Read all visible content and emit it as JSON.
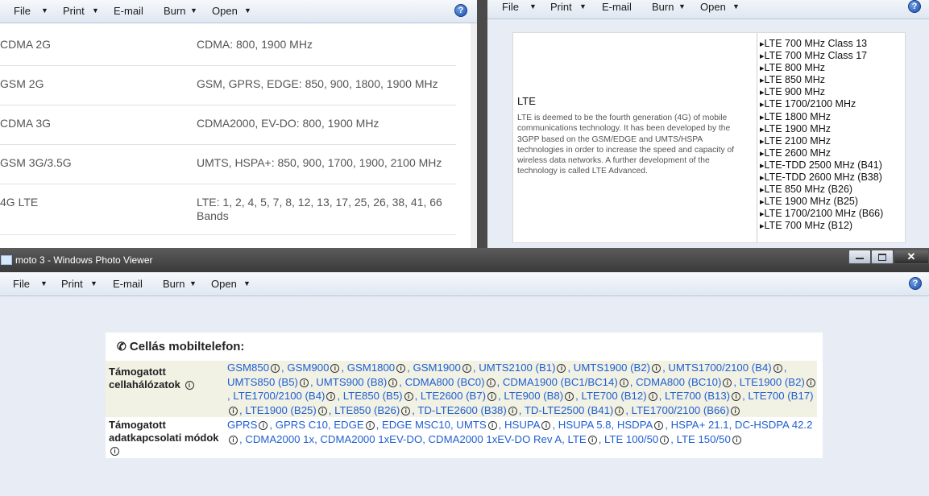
{
  "menu": {
    "file": "File",
    "print": "Print",
    "email": "E-mail",
    "burn": "Burn",
    "open": "Open"
  },
  "help_glyph": "?",
  "left_window": {
    "rows": [
      {
        "tech": "CDMA 2G",
        "bands": "CDMA: 800, 1900 MHz"
      },
      {
        "tech": "GSM 2G",
        "bands": "GSM, GPRS, EDGE: 850, 900, 1800, 1900 MHz"
      },
      {
        "tech": "CDMA 3G",
        "bands": "CDMA2000, EV-DO: 800, 1900 MHz"
      },
      {
        "tech": "GSM 3G/3.5G",
        "bands": "UMTS, HSPA+: 850, 900, 1700, 1900, 2100 MHz"
      },
      {
        "tech": "4G LTE",
        "bands": "LTE: 1, 2, 4, 5, 7, 8, 12, 13, 17, 25, 26, 38, 41, 66 Bands"
      }
    ]
  },
  "right_window": {
    "lte_title": "LTE",
    "lte_description": "LTE is deemed to be the fourth generation (4G) of mobile communications technology. It has been developed by the 3GPP based on the GSM/EDGE and UMTS/HSPA technologies in order to increase the speed and capacity of wireless data networks. A further development of the technology is called LTE Advanced.",
    "bands": [
      "LTE 700 MHz Class 13",
      "LTE 700 MHz Class 17",
      "LTE 800 MHz",
      "LTE 850 MHz",
      "LTE 900 MHz",
      "LTE 1700/2100 MHz",
      "LTE 1800 MHz",
      "LTE 1900 MHz",
      "LTE 2100 MHz",
      "LTE 2600 MHz",
      "LTE-TDD 2500 MHz (B41)",
      "LTE-TDD 2600 MHz (B38)",
      "LTE 850 MHz (B26)",
      "LTE 1900 MHz (B25)",
      "LTE 1700/2100 MHz (B66)",
      "LTE 700 MHz (B12)"
    ]
  },
  "bottom_window": {
    "title": "moto 3 - Windows Photo Viewer",
    "heading": "Cellás mobiltelefon:",
    "networks_label": "Támogatott cellahálózatok",
    "networks": [
      "GSM850",
      "GSM900",
      "GSM1800",
      "GSM1900",
      "UMTS2100 (B1)",
      "UMTS1900 (B2)",
      "UMTS1700/2100 (B4)",
      "UMTS850 (B5)",
      "UMTS900 (B8)",
      "CDMA800 (BC0)",
      "CDMA1900 (BC1/BC14)",
      "CDMA800 (BC10)",
      "LTE1900 (B2)",
      "LTE1700/2100 (B4)",
      "LTE850 (B5)",
      "LTE2600 (B7)",
      "LTE900 (B8)",
      "LTE700 (B12)",
      "LTE700 (B13)",
      "LTE700 (B17)",
      "LTE1900 (B25)",
      "LTE850 (B26)",
      "TD-LTE2600 (B38)",
      "TD-LTE2500 (B41)",
      "LTE1700/2100 (B66)"
    ],
    "data_label": "Támogatott adatkapcsolati módok",
    "data_modes": [
      "GPRS",
      "GPRS C10, EDGE",
      "EDGE MSC10, UMTS",
      "HSUPA",
      "HSUPA 5.8, HSDPA",
      "HSPA+ 21.1, DC-HSDPA 42.2",
      "CDMA2000 1x, CDMA2000 1xEV-DO, CDMA2000 1xEV-DO Rev A, LTE",
      "LTE 100/50",
      "LTE 150/50"
    ]
  },
  "colors": {
    "link": "#1f5fd1",
    "spec_bg": "#f1f1e4",
    "desktop": "#e8edf5"
  }
}
